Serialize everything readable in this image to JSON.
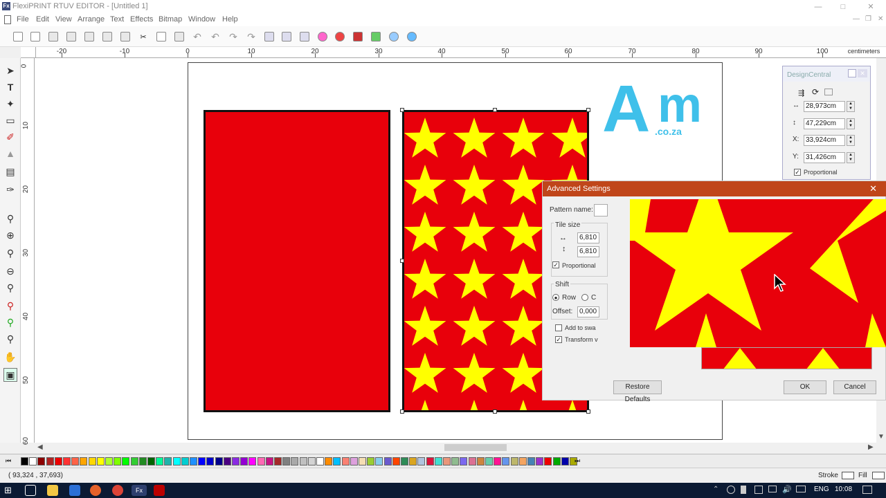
{
  "window": {
    "title": "FlexiPRINT RTUV EDITOR - [Untitled 1]",
    "app_icon": "Fx",
    "controls": [
      "minimize-icon",
      "maximize-icon",
      "close-icon"
    ]
  },
  "menu": [
    "File",
    "Edit",
    "View",
    "Arrange",
    "Text",
    "Effects",
    "Bitmap",
    "Window",
    "Help"
  ],
  "ruler": {
    "unit": "centimeters",
    "h_labels": [
      "-20",
      "-10",
      "0",
      "10",
      "20",
      "30",
      "40",
      "50",
      "60",
      "70",
      "80",
      "90",
      "100"
    ],
    "v_labels": [
      "0",
      "10",
      "20",
      "30",
      "40",
      "50",
      "60"
    ]
  },
  "logo": {
    "big_a": "A",
    "big_m": "m",
    "domain": ".co.za"
  },
  "design_central": {
    "title": "DesignCentral",
    "width": "28,973cm",
    "height": "47,229cm",
    "x_label": "X:",
    "x": "33,924cm",
    "y_label": "Y:",
    "y": "31,426cm",
    "proportional": "Proportional"
  },
  "advanced_settings": {
    "title": "Advanced Settings",
    "pattern_name_label": "Pattern name:",
    "tile_size_label": "Tile size",
    "tile_width": "6,810",
    "tile_height": "6,810",
    "proportional": "Proportional",
    "shift_label": "Shift",
    "row_label": "Row",
    "column_label": "C",
    "offset_label": "Offset:",
    "offset": "0,000",
    "add_to_swatch": "Add to swa",
    "transform": "Transform v",
    "restore_defaults": "Restore Defaults",
    "ok": "OK",
    "cancel": "Cancel"
  },
  "status": {
    "coords": "( 93,324 ,  37,693)",
    "stroke": "Stroke",
    "fill": "Fill"
  },
  "taskbar": {
    "lang": "ENG",
    "time": "10:08"
  },
  "colors": {
    "red": "#e8000b",
    "star_yellow": "#ffff00",
    "dialog_title": "#c0461a",
    "logo_blue": "#3fc0ea"
  }
}
